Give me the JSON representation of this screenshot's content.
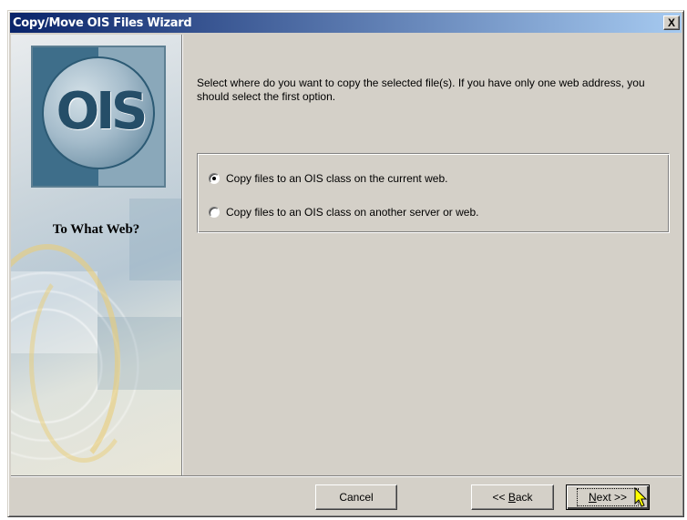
{
  "window": {
    "title": "Copy/Move OIS Files Wizard",
    "close_label": "X"
  },
  "side": {
    "logo_text": "OIS",
    "heading": "To What Web?"
  },
  "main": {
    "instructions": "Select where do you want to copy the selected file(s).  If you have only one web address, you should select the first option.",
    "options": [
      {
        "label": "Copy files to an OIS class on the current web.",
        "selected": true
      },
      {
        "label": "Copy files to an OIS class on another server or web.",
        "selected": false
      }
    ]
  },
  "buttons": {
    "cancel": "Cancel",
    "back_prefix": "<< ",
    "back_mnemonic": "B",
    "back_rest": "ack",
    "next_mnemonic": "N",
    "next_rest": "ext >>"
  },
  "colors": {
    "titlebar_start": "#0a246a",
    "titlebar_end": "#a6caf0",
    "dialog_face": "#d4d0c8"
  }
}
